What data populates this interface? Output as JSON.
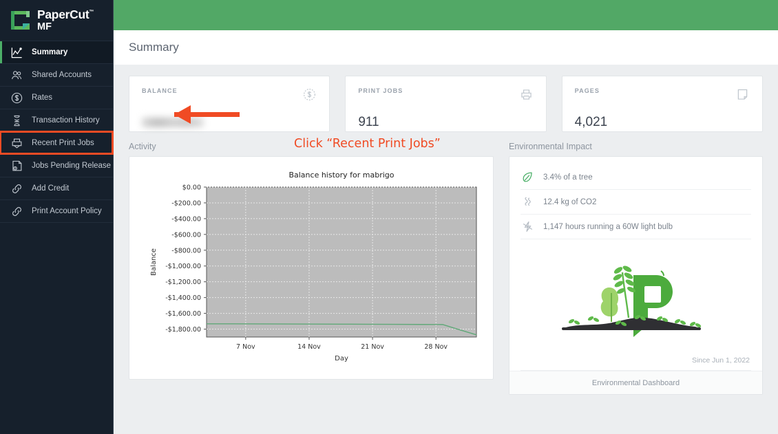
{
  "brand": {
    "name": "PaperCut",
    "trademark": "™",
    "edition": "MF",
    "accent_green": "#52a866",
    "logo_icon": "papercut-logo-icon"
  },
  "sidebar": {
    "items": [
      {
        "label": "Summary",
        "icon": "chart-line-icon",
        "active": true,
        "highlighted": false
      },
      {
        "label": "Shared Accounts",
        "icon": "users-icon",
        "active": false,
        "highlighted": false
      },
      {
        "label": "Rates",
        "icon": "dollar-circle-icon",
        "active": false,
        "highlighted": false
      },
      {
        "label": "Transaction History",
        "icon": "hourglass-icon",
        "active": false,
        "highlighted": false
      },
      {
        "label": "Recent Print Jobs",
        "icon": "printer-icon",
        "active": false,
        "highlighted": true
      },
      {
        "label": "Jobs Pending Release",
        "icon": "document-clock-icon",
        "active": false,
        "highlighted": false
      },
      {
        "label": "Add Credit",
        "icon": "link-icon",
        "active": false,
        "highlighted": false
      },
      {
        "label": "Print Account Policy",
        "icon": "link-icon",
        "active": false,
        "highlighted": false
      }
    ]
  },
  "header": {
    "title": "Summary"
  },
  "cards": [
    {
      "label": "BALANCE",
      "value": "",
      "redacted": true,
      "icon": "dollar-circle-icon"
    },
    {
      "label": "PRINT JOBS",
      "value": "911",
      "redacted": false,
      "icon": "printer-icon"
    },
    {
      "label": "PAGES",
      "value": "4,021",
      "redacted": false,
      "icon": "page-icon"
    }
  ],
  "activity": {
    "title": "Activity"
  },
  "environmental": {
    "title": "Environmental Impact",
    "rows": [
      {
        "icon": "leaf-icon",
        "text": "3.4% of a tree"
      },
      {
        "icon": "smoke-icon",
        "text": "12.4 kg of CO2"
      },
      {
        "icon": "lightning-icon",
        "text": "1,147 hours running a 60W light bulb"
      }
    ],
    "illustration": "papercut-plant-illustration",
    "since": "Since Jun 1, 2022",
    "footer_link": "Environmental Dashboard"
  },
  "annotation": {
    "text": "Click “Recent Print Jobs”",
    "color": "#f04b24",
    "arrow": "left-arrow-annotation"
  },
  "chart_data": {
    "type": "line",
    "title": "Balance history for mabrigo",
    "xlabel": "Day",
    "ylabel": "Balance",
    "ylim": [
      -1900,
      0
    ],
    "yticks": [
      0,
      -200,
      -400,
      -600,
      -800,
      -1000,
      -1200,
      -1400,
      -1600,
      -1800
    ],
    "yticklabels": [
      "$0.00",
      "-$200.00",
      "-$400.00",
      "-$600.00",
      "-$800.00",
      "-$1,000.00",
      "-$1,200.00",
      "-$1,400.00",
      "-$1,600.00",
      "-$1,800.00"
    ],
    "xticklabels": [
      "7 Nov",
      "14 Nov",
      "21 Nov",
      "28 Nov"
    ],
    "xtick_positions": [
      0.145,
      0.38,
      0.615,
      0.85
    ],
    "grid": true,
    "plot_bgcolor": "#bcbcbc",
    "line_color": "#5fa877",
    "series": [
      {
        "name": "Balance",
        "x": [
          0.0,
          0.1,
          0.2,
          0.3,
          0.4,
          0.5,
          0.6,
          0.7,
          0.8,
          0.875,
          0.93,
          1.0
        ],
        "values": [
          -1733,
          -1733,
          -1734,
          -1735,
          -1736,
          -1737,
          -1738,
          -1739,
          -1741,
          -1742,
          -1800,
          -1872
        ]
      }
    ]
  }
}
